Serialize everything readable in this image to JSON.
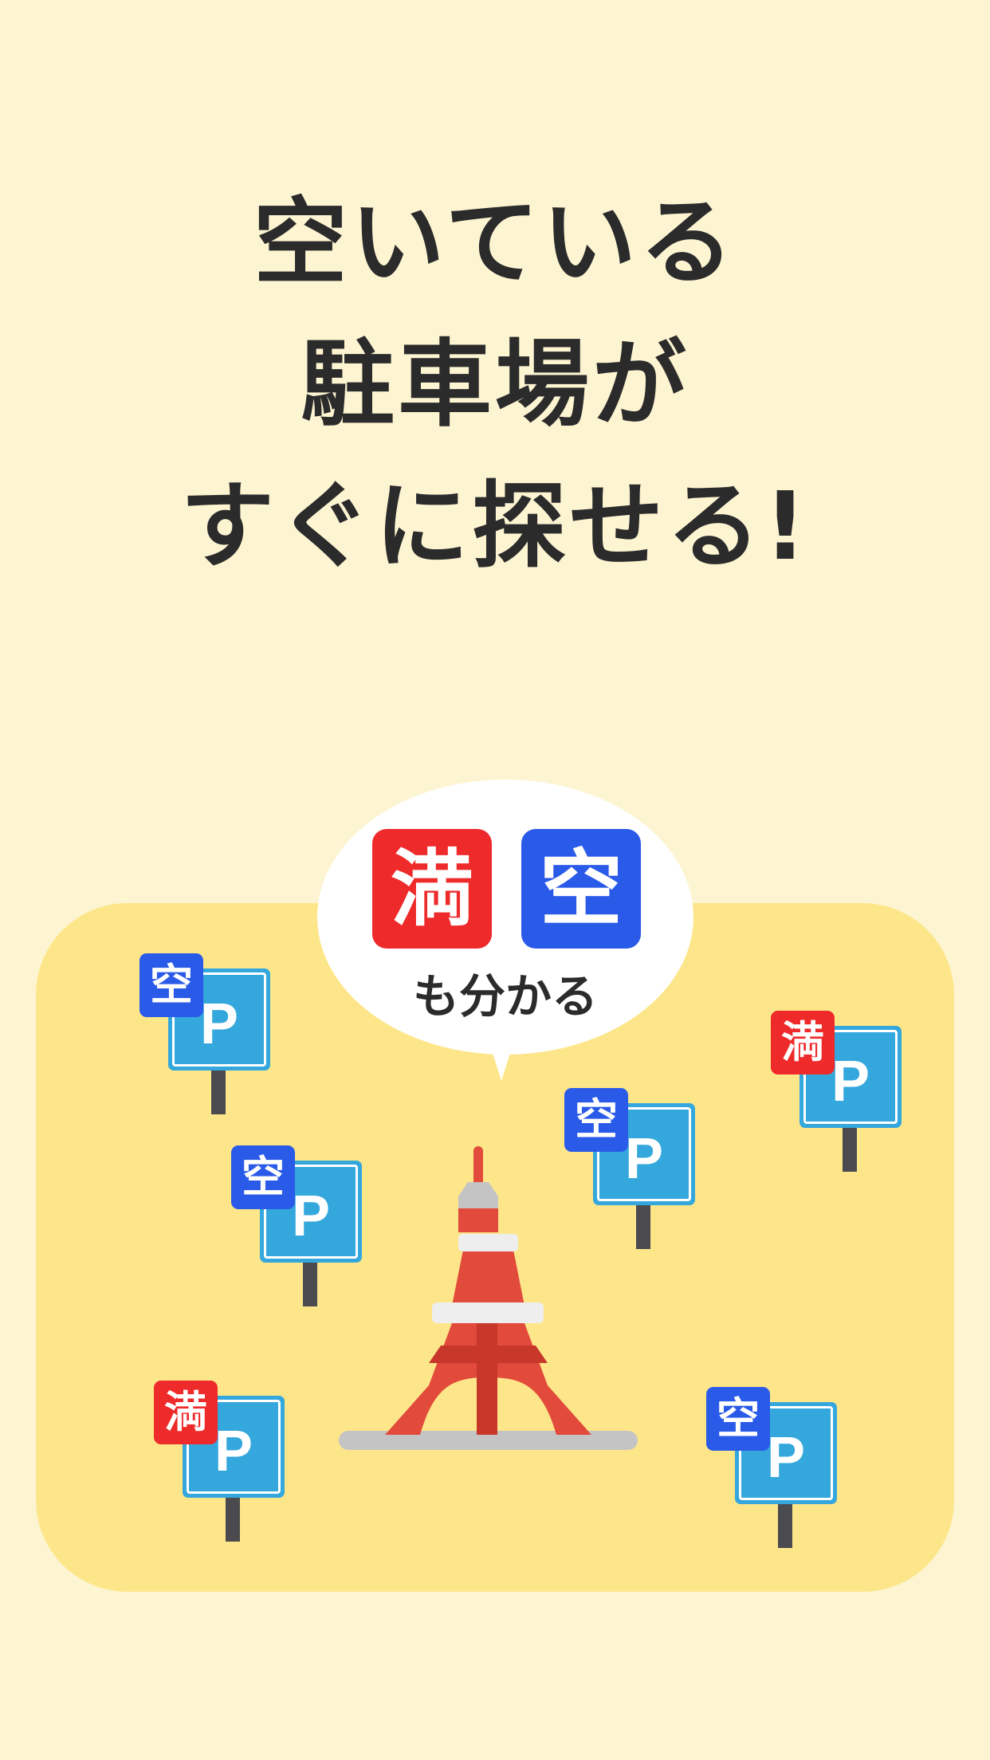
{
  "headline": {
    "line1": "空いている",
    "line2": "駐車場が",
    "line3": "すぐに探せる!"
  },
  "bubble": {
    "tag_full": "満",
    "tag_empty": "空",
    "caption": "も分かる"
  },
  "signs": [
    {
      "status": "空",
      "letter": "P"
    },
    {
      "status": "満",
      "letter": "P"
    },
    {
      "status": "空",
      "letter": "P"
    },
    {
      "status": "空",
      "letter": "P"
    },
    {
      "status": "満",
      "letter": "P"
    },
    {
      "status": "空",
      "letter": "P"
    }
  ],
  "colors": {
    "background": "#fdf5d2",
    "panel": "#fde68a",
    "full_red": "#ee2a2a",
    "empty_blue": "#2a5ae8",
    "sign_blue": "#34a7dd",
    "tower_red": "#e24a3b"
  }
}
